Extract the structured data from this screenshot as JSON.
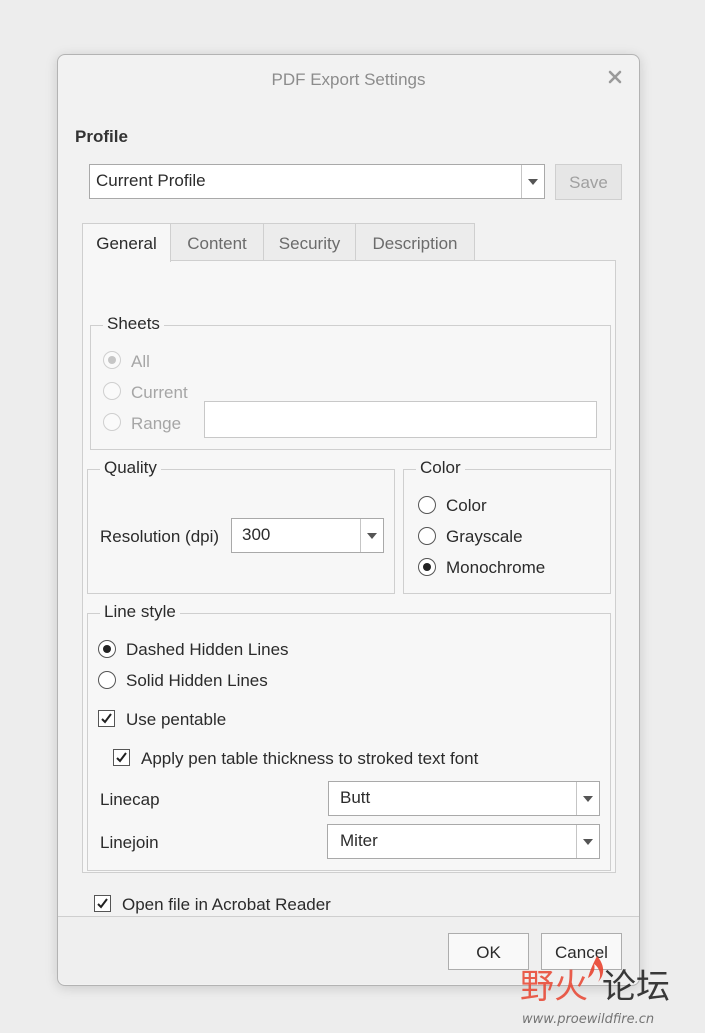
{
  "dialog": {
    "title": "PDF Export Settings",
    "profile_label": "Profile",
    "profile_value": "Current Profile",
    "save_label": "Save"
  },
  "tabs": [
    {
      "label": "General",
      "active": true
    },
    {
      "label": "Content",
      "active": false
    },
    {
      "label": "Security",
      "active": false
    },
    {
      "label": "Description",
      "active": false
    }
  ],
  "sheets": {
    "legend": "Sheets",
    "options": [
      "All",
      "Current",
      "Range"
    ],
    "selected": "All",
    "enabled": false,
    "range_value": ""
  },
  "quality": {
    "legend": "Quality",
    "resolution_label": "Resolution (dpi)",
    "resolution_value": "300"
  },
  "color": {
    "legend": "Color",
    "options": [
      "Color",
      "Grayscale",
      "Monochrome"
    ],
    "selected": "Monochrome"
  },
  "line_style": {
    "legend": "Line style",
    "options": [
      "Dashed Hidden Lines",
      "Solid Hidden Lines"
    ],
    "selected": "Dashed Hidden Lines",
    "use_pentable_label": "Use pentable",
    "use_pentable_checked": true,
    "apply_pen_label": "Apply pen table thickness to stroked text font",
    "apply_pen_checked": true,
    "linecap_label": "Linecap",
    "linecap_value": "Butt",
    "linejoin_label": "Linejoin",
    "linejoin_value": "Miter"
  },
  "open_acrobat": {
    "label": "Open file in Acrobat Reader",
    "checked": true
  },
  "footer": {
    "ok_label": "OK",
    "cancel_label": "Cancel"
  },
  "watermark": {
    "text": "野火论坛",
    "url": "www.proewildfire.cn"
  },
  "colors": {
    "watermark_red": "#e8432f",
    "watermark_dark": "#1a1a1a"
  }
}
